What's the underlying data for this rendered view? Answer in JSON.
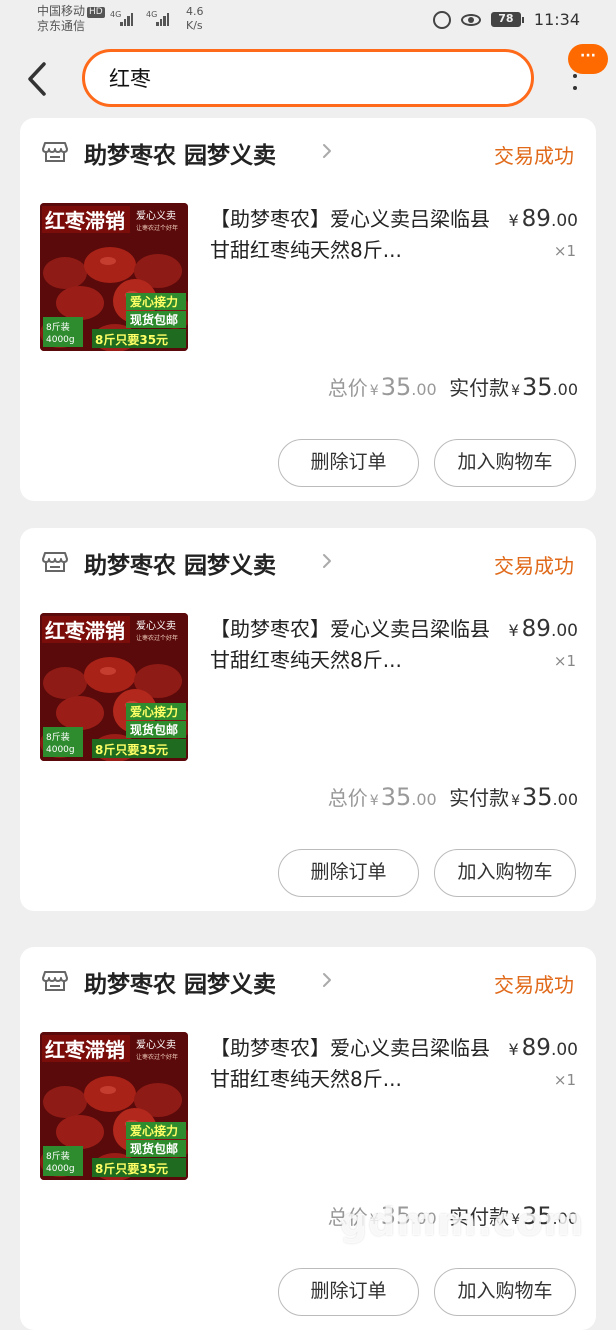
{
  "status_bar": {
    "carrier1": "中国移动",
    "carrier1_badge": "HD",
    "carrier2": "京东通信",
    "signal1_label": "4G",
    "signal2_label": "4G",
    "speed_value": "4.6",
    "speed_unit": "K/s",
    "battery": "78",
    "time": "11:34"
  },
  "header": {
    "back_icon": "chevron-left-icon",
    "search_value": "红枣",
    "more_badge": "···",
    "accent_color": "#ff6a1a"
  },
  "orders": [
    {
      "shop_name": "助梦枣农 园梦义卖",
      "status": "交易成功",
      "title": "【助梦枣农】爱心义卖吕梁临县甘甜红枣纯天然8斤...",
      "price_int": "89",
      "price_dec": ".00",
      "currency": "¥",
      "qty": "×1",
      "total_label": "总价",
      "total_int": "35",
      "total_dec": ".00",
      "paid_label": "实付款",
      "paid_int": "35",
      "paid_dec": ".00",
      "btn_delete": "删除订单",
      "btn_cart": "加入购物车",
      "image_text": {
        "banner": "红枣滞销",
        "tag": "爱心义卖",
        "sub": "让枣农过个好年",
        "line1": "爱心接力",
        "line2": "现货包邮",
        "line3": "8斤只要35元",
        "weight1": "8斤装",
        "weight2": "4000g"
      }
    },
    {
      "shop_name": "助梦枣农 园梦义卖",
      "status": "交易成功",
      "title": "【助梦枣农】爱心义卖吕梁临县甘甜红枣纯天然8斤...",
      "price_int": "89",
      "price_dec": ".00",
      "currency": "¥",
      "qty": "×1",
      "total_label": "总价",
      "total_int": "35",
      "total_dec": ".00",
      "paid_label": "实付款",
      "paid_int": "35",
      "paid_dec": ".00",
      "btn_delete": "删除订单",
      "btn_cart": "加入购物车",
      "image_text": {
        "banner": "红枣滞销",
        "tag": "爱心义卖",
        "sub": "让枣农过个好年",
        "line1": "爱心接力",
        "line2": "现货包邮",
        "line3": "8斤只要35元",
        "weight1": "8斤装",
        "weight2": "4000g"
      }
    },
    {
      "shop_name": "助梦枣农 园梦义卖",
      "status": "交易成功",
      "title": "【助梦枣农】爱心义卖吕梁临县甘甜红枣纯天然8斤...",
      "price_int": "89",
      "price_dec": ".00",
      "currency": "¥",
      "qty": "×1",
      "total_label": "总价",
      "total_int": "35",
      "total_dec": ".00",
      "paid_label": "实付款",
      "paid_int": "35",
      "paid_dec": ".00",
      "btn_delete": "删除订单",
      "btn_cart": "加入购物车",
      "image_text": {
        "banner": "红枣滞销",
        "tag": "爱心义卖",
        "sub": "让枣农过个好年",
        "line1": "爱心接力",
        "line2": "现货包邮",
        "line3": "8斤只要35元",
        "weight1": "8斤装",
        "weight2": "4000g"
      }
    }
  ],
  "watermark": "gdmm.com"
}
